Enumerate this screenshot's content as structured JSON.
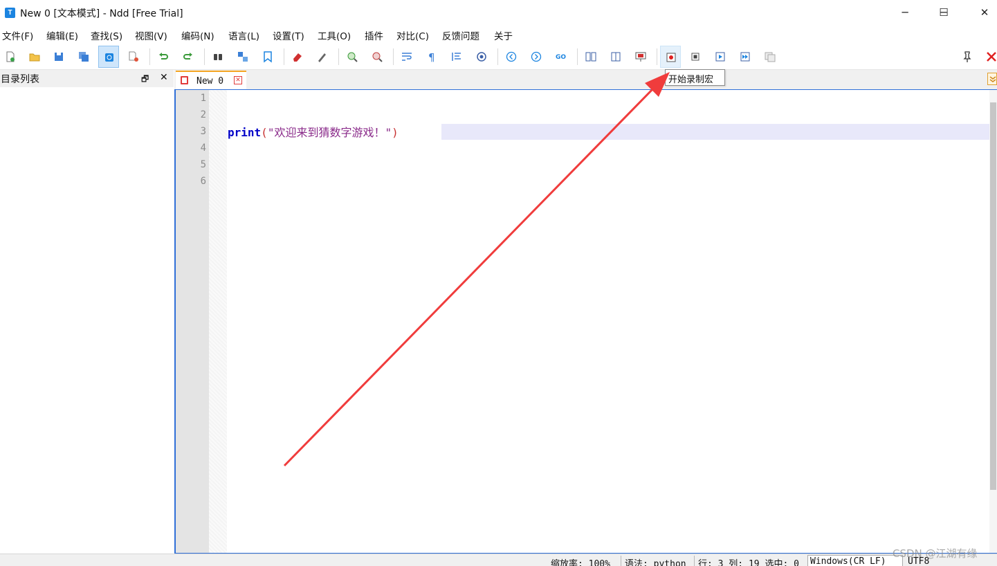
{
  "window": {
    "title": "New 0 [文本模式] - Ndd [Free Trial]",
    "app_icon_letter": "T",
    "minimize": "─",
    "maximize": "☐",
    "close": "✕"
  },
  "menu": [
    "文件(F)",
    "编辑(E)",
    "查找(S)",
    "视图(V)",
    "编码(N)",
    "语言(L)",
    "设置(T)",
    "工具(O)",
    "插件",
    "对比(C)",
    "反馈问题",
    "关于"
  ],
  "tooltip": "开始录制宏",
  "side_panel": {
    "title": "目录列表",
    "restore": "🗗",
    "close": "✕"
  },
  "tab": {
    "label": "New  0",
    "close": "✕"
  },
  "editor": {
    "line_numbers": [
      "1",
      "2",
      "3",
      "4",
      "5",
      "6"
    ],
    "code_keyword": "print",
    "code_open": "(",
    "code_string": "\"欢迎来到猜数字游戏！\"",
    "code_close": ")"
  },
  "status": {
    "zoom": "缩放率: 100%",
    "language": "语法: python",
    "position": "行: 3  列: 19  选中: 0",
    "line_ending": "Windows(CR LF)",
    "encoding": "UTF8"
  },
  "watermark": "CSDN @江湖有缘",
  "colors": {
    "accent": "#1b84e0",
    "tab_highlight": "#f5a623",
    "arrow": "#f03c3c",
    "editor_border": "#2f6fd8",
    "caret_line": "#e8e8fa"
  }
}
